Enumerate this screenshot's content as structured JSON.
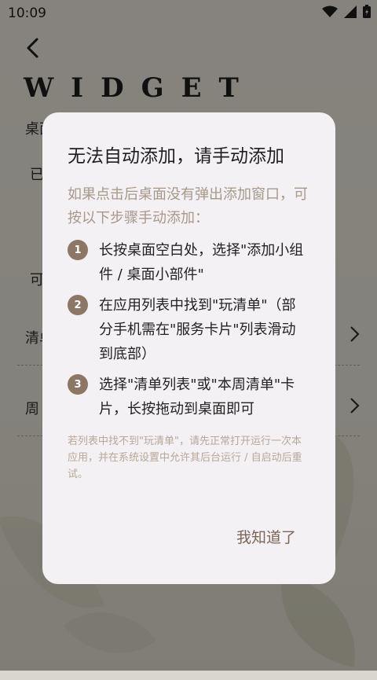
{
  "status_bar": {
    "time": "10:09"
  },
  "background": {
    "title": "WIDGET",
    "row1": "桌面",
    "row2": "已",
    "row3": "可",
    "row4": "清单",
    "row5": "周"
  },
  "dialog": {
    "title": "无法自动添加，请手动添加",
    "intro": "如果点击后桌面没有弹出添加窗口，可按以下步骤手动添加：",
    "steps": [
      {
        "num": "1",
        "text": "长按桌面空白处，选择\"添加小组件 / 桌面小部件\""
      },
      {
        "num": "2",
        "text": "在应用列表中找到\"玩清单\"（部分手机需在\"服务卡片\"列表滑动到底部）"
      },
      {
        "num": "3",
        "text": "选择\"清单列表\"或\"本周清单\"卡片，长按拖动到桌面即可"
      }
    ],
    "note": "若列表中找不到\"玩清单\"，请先正常打开运行一次本应用，并在系统设置中允许其后台运行 / 自启动后重试。",
    "confirm_label": "我知道了"
  },
  "colors": {
    "accent": "#8c7765",
    "intro_text": "#a8988a",
    "dialog_bg": "#f4f1f4"
  }
}
